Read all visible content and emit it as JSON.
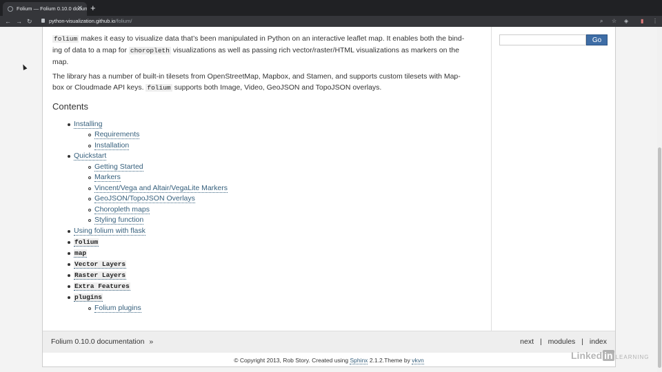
{
  "browser": {
    "tab_title": "Folium — Folium 0.10.0 docum",
    "url_host": "python-visualization.github.io",
    "url_path": "/folium/"
  },
  "sidebar": {
    "go_label": "Go"
  },
  "intro": {
    "p1_a": "makes it easy to visualize data that’s been manipulated in Python on an interactive leaflet map. It enables both the bind-",
    "p1_b": "ing of data to a map for",
    "p1_c": "visualizations as well as passing rich vector/raster/HTML visualizations as markers on the",
    "p1_d": "map.",
    "code_folium": "folium",
    "code_choropleth": "choropleth",
    "p2_a": "The library has a number of built-in tilesets from OpenStreetMap, Mapbox, and Stamen, and supports custom tilesets with Map-",
    "p2_b": "box or Cloudmade API keys.",
    "p2_c": "supports both Image, Video, GeoJSON and TopoJSON overlays."
  },
  "contents": {
    "title": "Contents",
    "items": [
      "Installing",
      "Requirements",
      "Installation",
      "Quickstart",
      "Getting Started",
      "Markers",
      "Vincent/Vega and Altair/VegaLite Markers",
      "GeoJSON/TopoJSON Overlays",
      "Choropleth maps",
      "Styling function",
      "Using folium with flask",
      "folium",
      "map",
      "Vector Layers",
      "Raster Layers",
      "Extra Features",
      "plugins",
      "Folium plugins"
    ]
  },
  "relbar": {
    "doc_title": "Folium 0.10.0 documentation",
    "arrow": "»",
    "next": "next",
    "sep": "|",
    "modules": "modules",
    "index": "index"
  },
  "footer": {
    "text_a": "© Copyright 2013, Rob Story. Created using",
    "sphinx": "Sphinx",
    "text_b": "2.1.2.Theme by",
    "vkvn": "vkvn"
  },
  "watermark": {
    "linked": "Linked",
    "in": "in",
    "learning": "LEARNING"
  }
}
